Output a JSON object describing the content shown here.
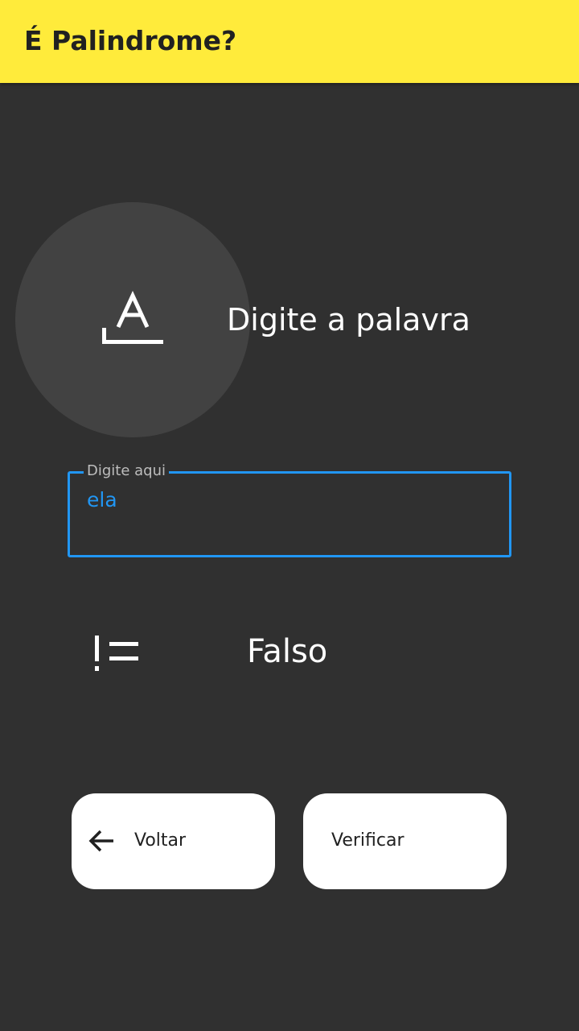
{
  "theme": {
    "accent": "#FFEB3B",
    "background": "#303030",
    "field_focus": "#2196F3"
  },
  "app_bar": {
    "title": "É Palindrome?"
  },
  "prompt": {
    "icon": "text-format-icon",
    "label": "Digite a palavra"
  },
  "input": {
    "label": "Digite aqui",
    "value": "ela"
  },
  "result": {
    "icon": "not-equal-icon",
    "text": "Falso"
  },
  "buttons": {
    "back": {
      "icon": "arrow-back-icon",
      "label": "Voltar"
    },
    "verify": {
      "label": "Verificar"
    }
  }
}
